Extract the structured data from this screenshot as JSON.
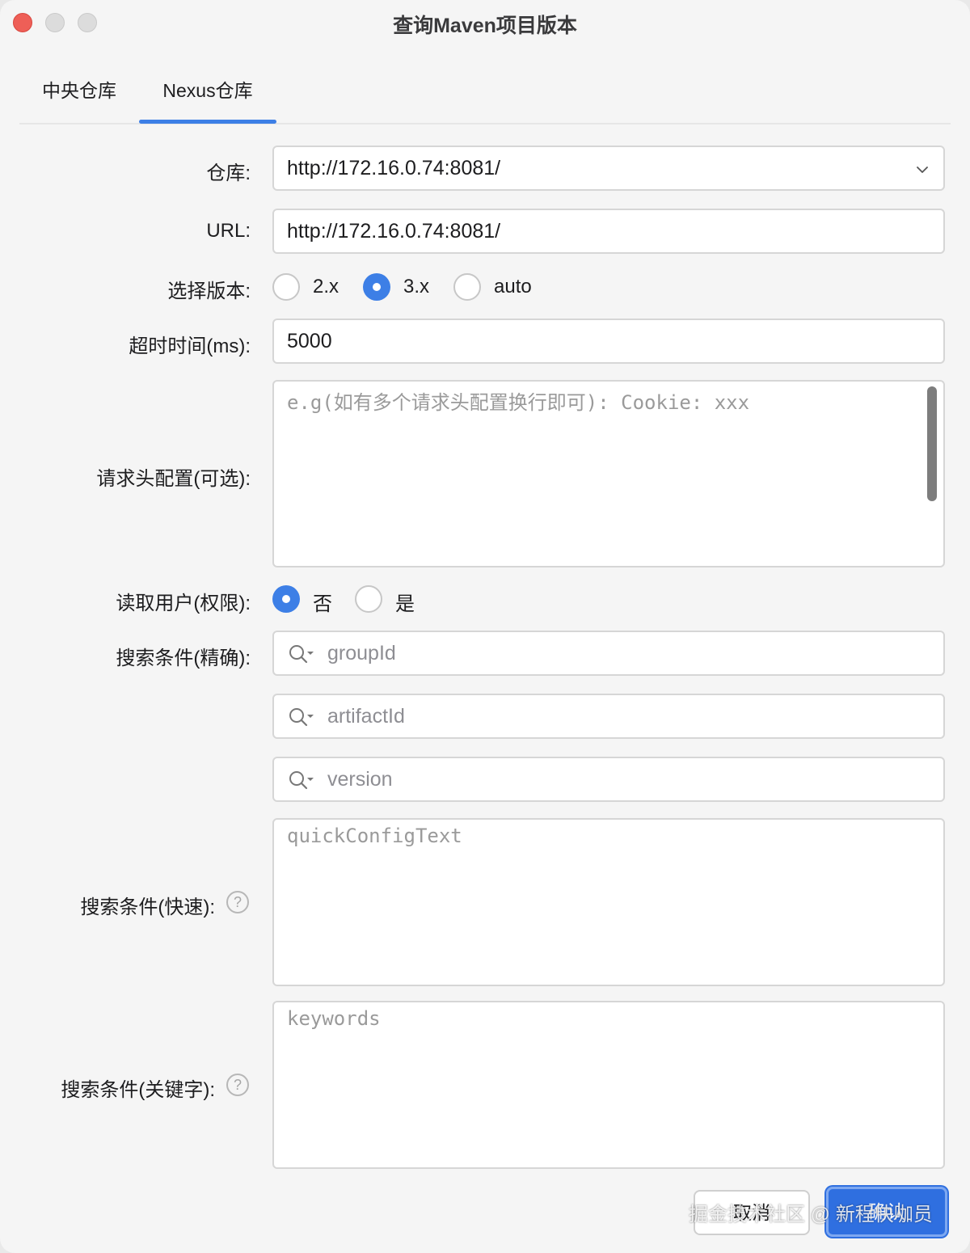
{
  "window": {
    "title": "查询Maven项目版本"
  },
  "tabs": [
    {
      "label": "中央仓库",
      "active": false
    },
    {
      "label": "Nexus仓库",
      "active": true
    }
  ],
  "form": {
    "repository": {
      "label": "仓库:",
      "value": "http://172.16.0.74:8081/"
    },
    "url": {
      "label": "URL:",
      "value": "http://172.16.0.74:8081/"
    },
    "version": {
      "label": "选择版本:",
      "options": [
        {
          "label": "2.x",
          "selected": false
        },
        {
          "label": "3.x",
          "selected": true
        },
        {
          "label": "auto",
          "selected": false
        }
      ]
    },
    "timeout": {
      "label": "超时时间(ms):",
      "value": "5000"
    },
    "headers": {
      "label": "请求头配置(可选):",
      "placeholder": "e.g(如有多个请求头配置换行即可): Cookie: xxx"
    },
    "read_user": {
      "label": "读取用户(权限):",
      "options": [
        {
          "label": "否",
          "selected": true
        },
        {
          "label": "是",
          "selected": false
        }
      ]
    },
    "exact_search": {
      "label": "搜索条件(精确):",
      "group_placeholder": "groupId",
      "artifact_placeholder": "artifactId",
      "version_placeholder": "version"
    },
    "quick_search": {
      "label": "搜索条件(快速):",
      "placeholder": "quickConfigText"
    },
    "keyword_search": {
      "label": "搜索条件(关键字):",
      "placeholder": "keywords"
    }
  },
  "buttons": {
    "cancel": "取消",
    "confirm": "确认"
  },
  "watermark": "掘金技术社区 @ 新程快咖员",
  "colors": {
    "accent": "#3d7fe6",
    "primary_button": "#2f6fe0",
    "close_button": "#ee5f57"
  }
}
